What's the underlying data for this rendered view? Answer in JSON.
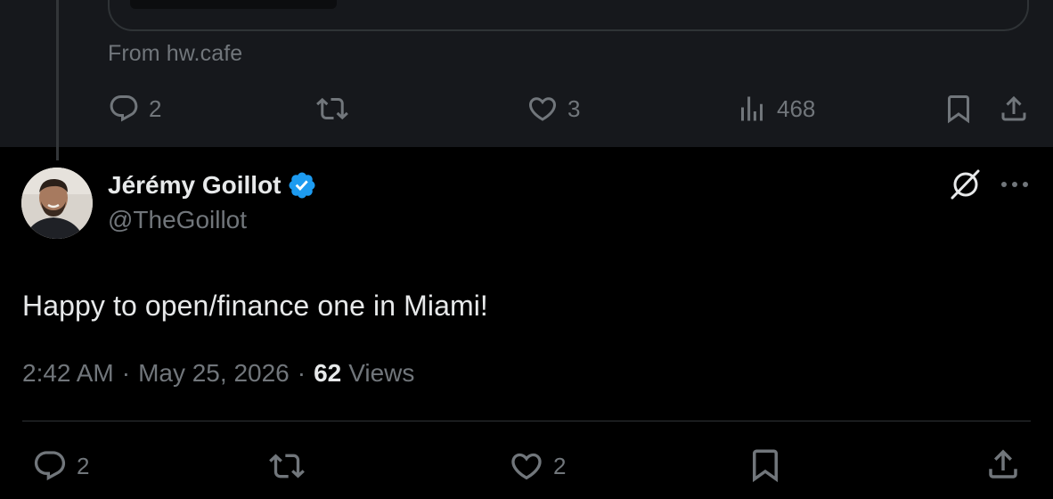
{
  "parent_tweet": {
    "source_label": "From hw.cafe",
    "actions": {
      "replies": "2",
      "reposts": "",
      "likes": "3",
      "views": "468"
    }
  },
  "tweet": {
    "author_name": "Jérémy Goillot",
    "handle": "@TheGoillot",
    "verified": true,
    "text": "Happy to open/finance one in Miami!",
    "time": "2:42 AM",
    "date": "May 25, 2026",
    "separator": "·",
    "views_count": "62",
    "views_label": "Views",
    "actions": {
      "replies": "2",
      "reposts": "",
      "likes": "2"
    }
  },
  "icons": {
    "reply": "reply-icon",
    "repost": "repost-icon",
    "like": "like-icon",
    "views": "views-icon",
    "bookmark": "bookmark-icon",
    "share": "share-icon",
    "grok": "grok-icon",
    "more": "more-icon",
    "verified": "verified-badge-icon"
  },
  "colors": {
    "background": "#000000",
    "parent_background": "#16181c",
    "primary_text": "#e7e9ea",
    "secondary_text": "#71767b",
    "verified_blue": "#1d9bf0",
    "border": "#2f3336"
  }
}
